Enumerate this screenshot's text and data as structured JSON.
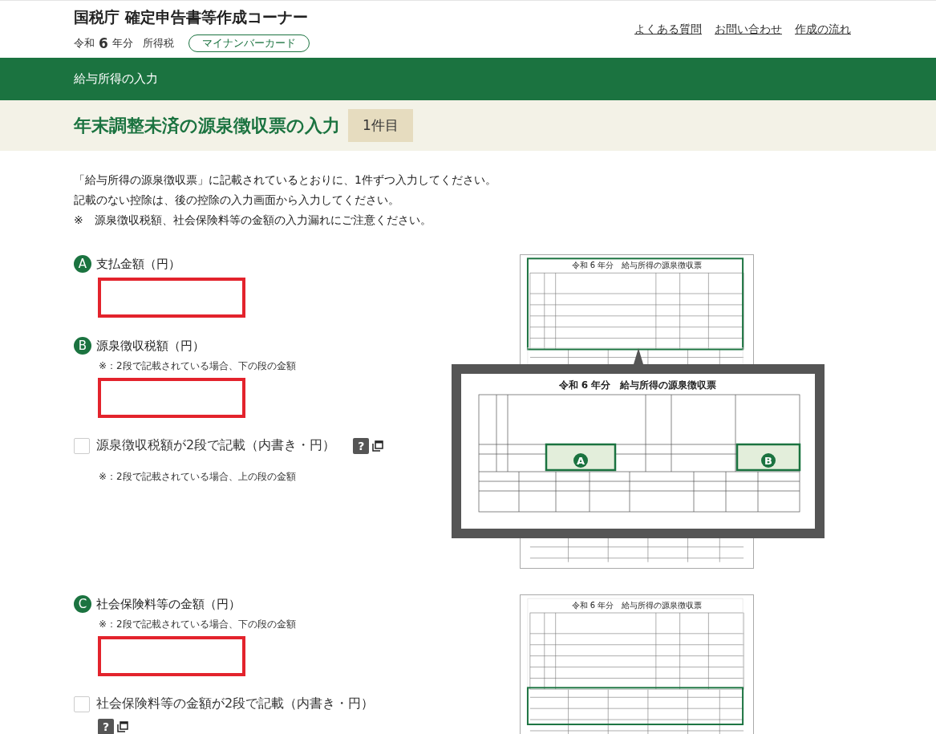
{
  "header": {
    "title": "国税庁 確定申告書等作成コーナー",
    "era": "令和",
    "year": "6",
    "year_suffix": "年分",
    "tax": "所得税",
    "badge": "マイナンバーカード",
    "links": [
      "よくある質問",
      "お問い合わせ",
      "作成の流れ"
    ]
  },
  "section_bar": "給与所得の入力",
  "heading": {
    "title": "年末調整未済の源泉徴収票の入力",
    "count": "1件目"
  },
  "instructions": [
    "「給与所得の源泉徴収票」に記載されているとおりに、1件ずつ入力してください。",
    "記載のない控除は、後の控除の入力画面から入力してください。",
    "※　源泉徴収税額、社会保険料等の金額の入力漏れにご注意ください。"
  ],
  "groups": [
    {
      "items": [
        {
          "kind": "amount",
          "marker": "A",
          "label": "支払金額（円）",
          "highlighted": true
        },
        {
          "kind": "amount",
          "marker": "B",
          "label": "源泉徴収税額（円）",
          "note": "※：2段で記載されている場合、下の段の金額",
          "highlighted": true
        },
        {
          "kind": "checkbox",
          "label": "源泉徴収税額が2段で記載（内書き・円）",
          "checked": false,
          "help": "?",
          "note": "※：2段で記載されている場合、上の段の金額"
        }
      ],
      "illustration": {
        "title": "令和 6 年分　給与所得の源泉徴収票",
        "top_highlighted": true,
        "middle_highlighted": false,
        "zoom": {
          "title": "令和 6 年分　給与所得の源泉徴収票",
          "markers": [
            "A",
            "B"
          ]
        }
      }
    },
    {
      "items": [
        {
          "kind": "amount",
          "marker": "C",
          "label": "社会保険料等の金額（円）",
          "note": "※：2段で記載されている場合、下の段の金額",
          "highlighted": true
        },
        {
          "kind": "checkbox",
          "label": "社会保険料等の金額が2段で記載（内書き・円）",
          "checked": false,
          "help": "?"
        }
      ],
      "illustration": {
        "title": "令和 6 年分　給与所得の源泉徴収票",
        "top_highlighted": false,
        "middle_highlighted": true
      }
    }
  ]
}
